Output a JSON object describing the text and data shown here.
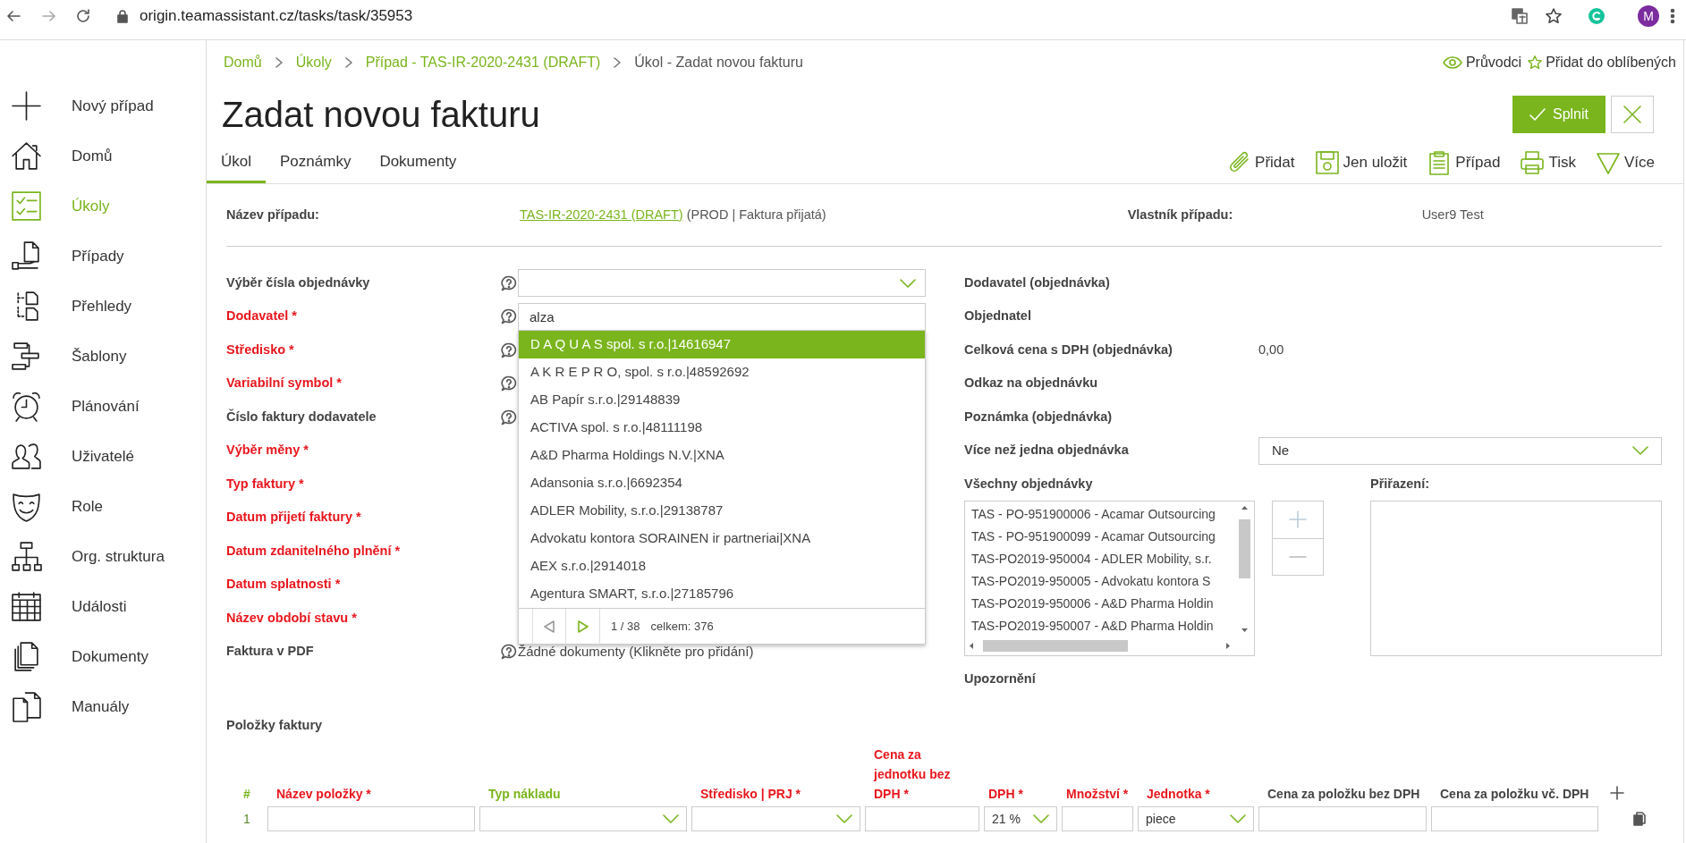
{
  "browser": {
    "url": "origin.teamassistant.cz/tasks/task/35953",
    "profile_initial": "M"
  },
  "sidebar": {
    "items": [
      {
        "label": "Nový případ",
        "selected": false
      },
      {
        "label": "Domů",
        "selected": false
      },
      {
        "label": "Úkoly",
        "selected": true
      },
      {
        "label": "Případy",
        "selected": false
      },
      {
        "label": "Přehledy",
        "selected": false
      },
      {
        "label": "Šablony",
        "selected": false
      },
      {
        "label": "Plánování",
        "selected": false
      },
      {
        "label": "Uživatelé",
        "selected": false
      },
      {
        "label": "Role",
        "selected": false
      },
      {
        "label": "Org. struktura",
        "selected": false
      },
      {
        "label": "Události",
        "selected": false
      },
      {
        "label": "Dokumenty",
        "selected": false
      },
      {
        "label": "Manuály",
        "selected": false
      }
    ]
  },
  "breadcrumb": [
    {
      "label": "Domů",
      "link": true
    },
    {
      "label": "Úkoly",
      "link": true
    },
    {
      "label": "Případ - TAS-IR-2020-2431 (DRAFT)",
      "link": true
    },
    {
      "label": "Úkol - Zadat novou fakturu",
      "link": false
    }
  ],
  "header_links": [
    "Průvodci",
    "Přidat do oblíbených"
  ],
  "title": "Zadat novou fakturu",
  "complete_button": "Splnit",
  "tabs": [
    {
      "label": "Úkol",
      "selected": true
    },
    {
      "label": "Poznámky",
      "selected": false
    },
    {
      "label": "Dokumenty",
      "selected": false
    }
  ],
  "toolbar": [
    "Přidat",
    "Jen uložit",
    "Případ",
    "Tisk",
    "Více"
  ],
  "case": {
    "label": "Název případu:",
    "link": "TAS-IR-2020-2431 (DRAFT)",
    "suffix": "(PROD | Faktura přijatá)",
    "owner_label": "Vlastník případu:",
    "owner": "User9 Test"
  },
  "form_left": [
    {
      "label": "Výběr čísla objednávky",
      "required": false,
      "help": true,
      "kind": "select"
    },
    {
      "label": "Dodavatel *",
      "required": true,
      "help": true,
      "kind": "input",
      "value": "alza"
    },
    {
      "label": "Středisko *",
      "required": true,
      "help": true
    },
    {
      "label": "Variabilní symbol *",
      "required": true,
      "help": true
    },
    {
      "label": "Číslo faktury dodavatele",
      "required": false,
      "help": true
    },
    {
      "label": "Výběr měny *",
      "required": true,
      "help": false
    },
    {
      "label": "Typ faktury *",
      "required": true,
      "help": false
    },
    {
      "label": "Datum přijetí faktury *",
      "required": true,
      "help": false
    },
    {
      "label": "Datum zdanitelného plnění *",
      "required": true,
      "help": false
    },
    {
      "label": "Datum splatnosti *",
      "required": true,
      "help": false
    },
    {
      "label": "Název období stavu *",
      "required": true,
      "help": false
    },
    {
      "label": "Faktura v PDF",
      "required": false,
      "help": true,
      "kind": "text",
      "value": "Žádné dokumenty (Klikněte pro přidání)"
    }
  ],
  "dropdown": {
    "items": [
      {
        "label": "D A Q U A S spol. s r.o.|14616947",
        "selected": true
      },
      {
        "label": "A K R E P R O, spol. s r.o.|48592692",
        "selected": false
      },
      {
        "label": "AB Papír s.r.o.|29148839",
        "selected": false
      },
      {
        "label": "ACTIVA spol. s r.o.|48111198",
        "selected": false
      },
      {
        "label": "A&D Pharma Holdings N.V.|XNA",
        "selected": false
      },
      {
        "label": "Adansonia s.r.o.|6692354",
        "selected": false
      },
      {
        "label": "ADLER Mobility, s.r.o.|29138787",
        "selected": false
      },
      {
        "label": "Advokatu kontora SORAINEN ir partneriai|XNA",
        "selected": false
      },
      {
        "label": "AEX s.r.o.|2914018",
        "selected": false
      },
      {
        "label": "Agentura SMART, s.r.o.|27185796",
        "selected": false
      }
    ],
    "page": "1 / 38",
    "total": "celkem: 376"
  },
  "form_right": [
    {
      "label": "Dodavatel (objednávka)"
    },
    {
      "label": "Objednatel"
    },
    {
      "label": "Celková cena s DPH (objednávka)",
      "kind": "value",
      "value": "0,00"
    },
    {
      "label": "Odkaz na objednávku"
    },
    {
      "label": "Poznámka (objednávka)"
    },
    {
      "label": "Více než jedna objednávka",
      "kind": "select",
      "value": "Ne"
    }
  ],
  "orders": {
    "label": "Všechny objednávky",
    "items": [
      "TAS - PO-951900006 - Acamar Outsourcing",
      "TAS - PO-951900099 - Acamar Outsourcing",
      "TAS-PO2019-950004 - ADLER Mobility, s.r.",
      "TAS-PO2019-950005 - Advokatu kontora S",
      "TAS-PO2019-950006 - A&D Pharma Holdin",
      "TAS-PO2019-950007 - A&D Pharma Holdin"
    ],
    "assigned_label": "Přiřazení:"
  },
  "warning_label": "Upozornění",
  "items_table": {
    "title": "Položky faktury",
    "columns": [
      {
        "label": "#",
        "color": "#7ab51d"
      },
      {
        "label": "Název položky *",
        "color": "#e8171e"
      },
      {
        "label": "Typ nákladu",
        "color": "#7ab51d"
      },
      {
        "label": "Středisko | PRJ *",
        "color": "#e8171e"
      },
      {
        "label": "Cena za jednotku bez DPH *",
        "color": "#e8171e"
      },
      {
        "label": "DPH *",
        "color": "#e8171e"
      },
      {
        "label": "Množství *",
        "color": "#e8171e"
      },
      {
        "label": "Jednotka *",
        "color": "#e8171e"
      },
      {
        "label": "Cena za položku bez DPH",
        "color": "#444444"
      },
      {
        "label": "Cena za položku vč. DPH",
        "color": "#444444"
      }
    ],
    "rows": [
      {
        "cells": [
          {
            "kind": "text",
            "value": "1"
          },
          {
            "kind": "input"
          },
          {
            "kind": "select"
          },
          {
            "kind": "select"
          },
          {
            "kind": "input"
          },
          {
            "kind": "select",
            "value": "21 %"
          },
          {
            "kind": "input"
          },
          {
            "kind": "select",
            "value": "piece"
          },
          {
            "kind": "input"
          },
          {
            "kind": "input"
          }
        ]
      }
    ]
  }
}
